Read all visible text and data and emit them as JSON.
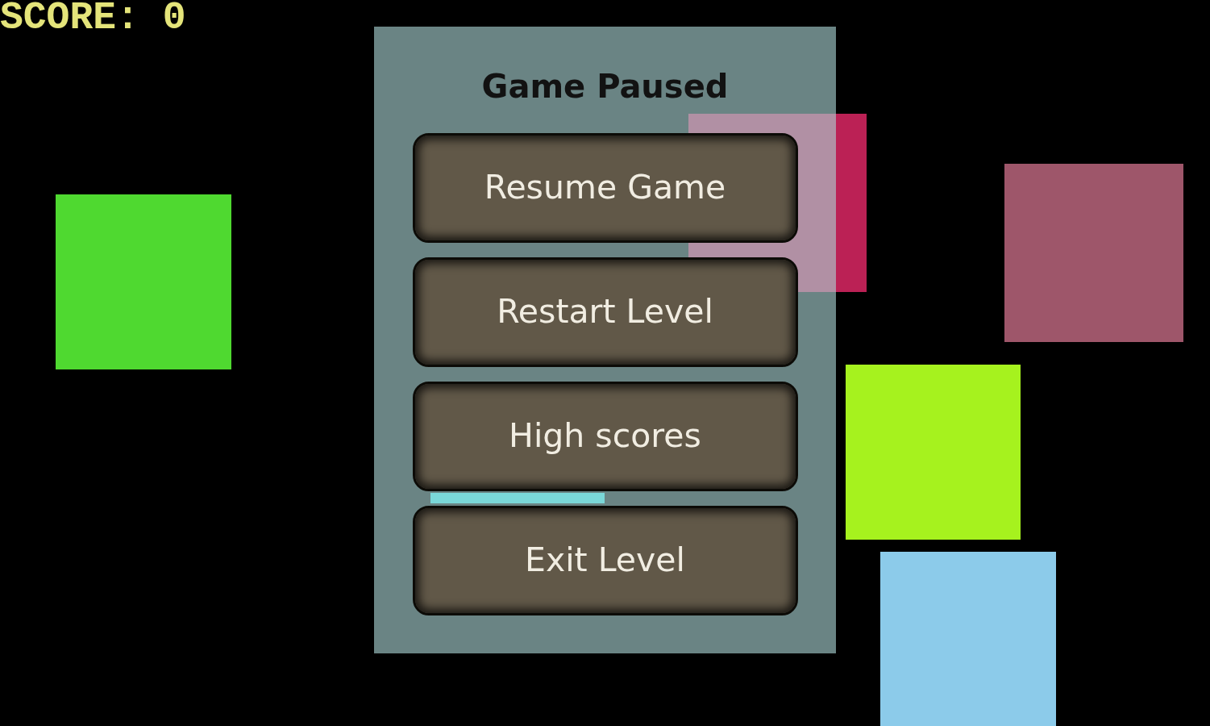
{
  "hud": {
    "score": "SCORE: 0"
  },
  "blocks": [
    {
      "color": "#4fd930"
    },
    {
      "color": "#bb2155"
    },
    {
      "color": "#9e566a"
    },
    {
      "color": "#a6f21e"
    },
    {
      "color": "#8ccbea"
    }
  ],
  "bar": {
    "color": "#7ad7d8"
  },
  "pause_menu": {
    "title": "Game Paused",
    "buttons": [
      "Resume Game",
      "Restart Level",
      "High scores",
      "Exit Level"
    ]
  }
}
